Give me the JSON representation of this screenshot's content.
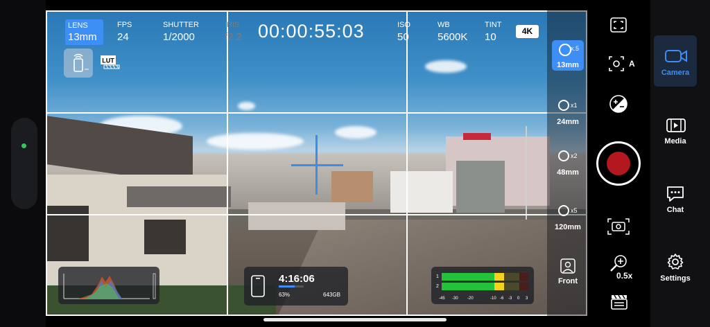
{
  "overlay": {
    "lens": {
      "label": "LENS",
      "value": "13mm"
    },
    "fps": {
      "label": "FPS",
      "value": "24"
    },
    "shutter": {
      "label": "SHUTTER",
      "value": "1/2000"
    },
    "iris": {
      "label": "IRIS",
      "value": "f2.2"
    },
    "timecode": "00:00:55:03",
    "iso": {
      "label": "ISO",
      "value": "50"
    },
    "wb": {
      "label": "WB",
      "value": "5600K"
    },
    "tint": {
      "label": "TINT",
      "value": "10"
    },
    "resolution": "4K",
    "lut_badge": "LUT"
  },
  "record_info": {
    "remaining_time": "4:16:06",
    "battery": "63%",
    "storage": "643GB",
    "progress": 0.63
  },
  "audio_meter": {
    "channels": [
      "1",
      "2"
    ],
    "scale": [
      "-45",
      "-30",
      "-20",
      "-10",
      "-6",
      "-3",
      "0",
      "3"
    ],
    "colors": {
      "green": "#23c23a",
      "yellow": "#f2d31b",
      "red": "#c0262c"
    }
  },
  "lenses": [
    {
      "mult": "x.5",
      "mm": "13mm",
      "active": true
    },
    {
      "mult": "x1",
      "mm": "24mm",
      "active": false
    },
    {
      "mult": "x2",
      "mm": "48mm",
      "active": false
    },
    {
      "mult": "x5",
      "mm": "120mm",
      "active": false
    },
    {
      "mult": "",
      "mm": "Front",
      "active": false
    }
  ],
  "controls": {
    "auto_focus_label": "A",
    "zoom_label": "0.5x"
  },
  "nav": {
    "items": [
      {
        "label": "Camera",
        "icon": "camera-icon",
        "active": true
      },
      {
        "label": "Media",
        "icon": "film-icon",
        "active": false
      },
      {
        "label": "Chat",
        "icon": "chat-icon",
        "active": false
      },
      {
        "label": "Settings",
        "icon": "gear-icon",
        "active": false
      }
    ]
  },
  "colors": {
    "accent": "#3d8ef5",
    "record": "#b3181e",
    "status_dot": "#31c75a"
  }
}
